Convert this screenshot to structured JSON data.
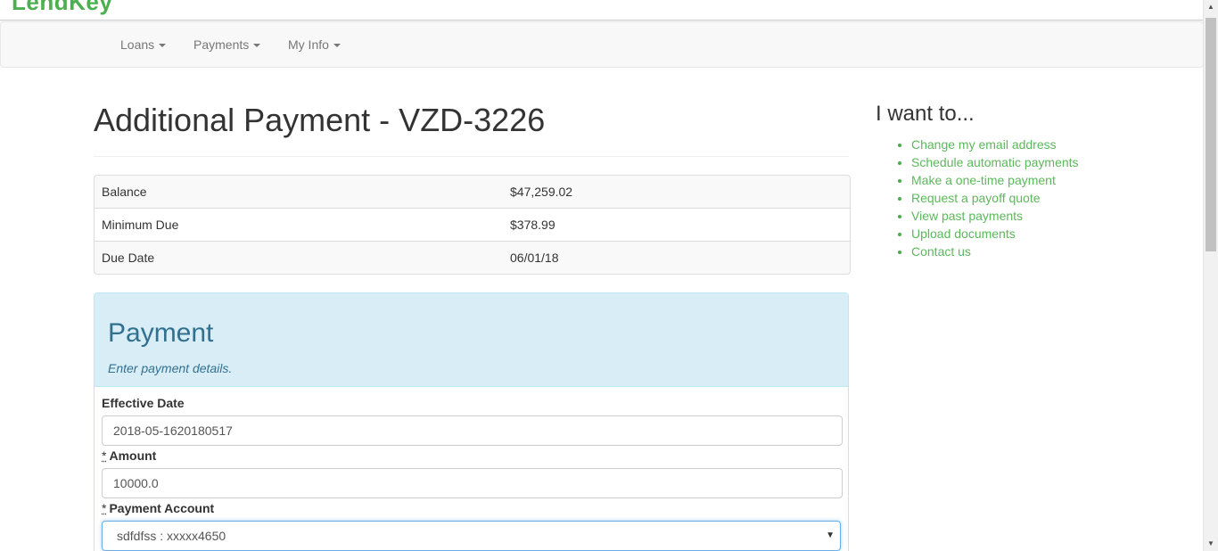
{
  "brand": {
    "logo_text": "LendKey",
    "color": "#4caf50"
  },
  "nav": {
    "items": [
      {
        "label": "Loans"
      },
      {
        "label": "Payments"
      },
      {
        "label": "My Info"
      }
    ]
  },
  "main": {
    "title": "Additional Payment - VZD-3226",
    "summary": [
      {
        "label": "Balance",
        "value": "$47,259.02"
      },
      {
        "label": "Minimum Due",
        "value": "$378.99"
      },
      {
        "label": "Due Date",
        "value": "06/01/18"
      }
    ],
    "panel": {
      "title": "Payment",
      "subtitle": "Enter payment details.",
      "fields": {
        "effective_date": {
          "label": "Effective Date",
          "value": "2018-05-1620180517"
        },
        "amount": {
          "required_mark": "*",
          "label": "Amount",
          "value": "10000.0"
        },
        "payment_account": {
          "required_mark": "*",
          "label": "Payment Account",
          "value": "sdfdfss : xxxxx4650"
        }
      }
    }
  },
  "sidebar": {
    "title": "I want to...",
    "links": [
      {
        "label": "Change my email address"
      },
      {
        "label": "Schedule automatic payments"
      },
      {
        "label": "Make a one-time payment"
      },
      {
        "label": "Request a payoff quote"
      },
      {
        "label": "View past payments"
      },
      {
        "label": "Upload documents"
      },
      {
        "label": "Contact us"
      }
    ]
  },
  "colors": {
    "link": "#5cb85c",
    "panel_heading_bg": "#d9edf7",
    "panel_text": "#31708f"
  }
}
